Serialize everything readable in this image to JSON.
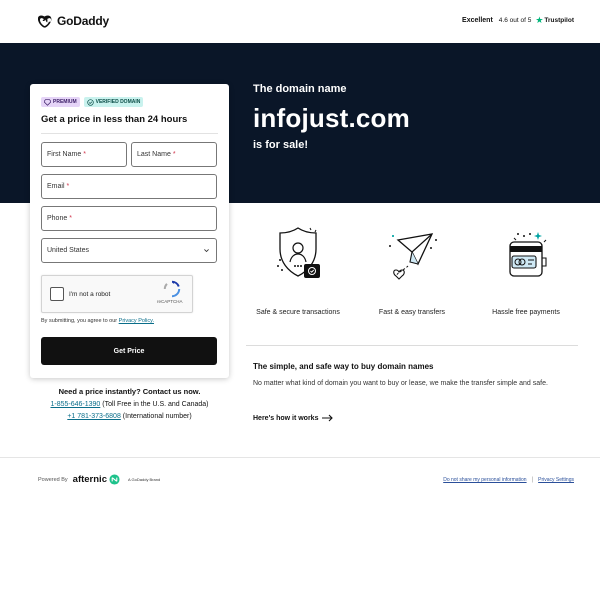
{
  "header": {
    "logo_text": "GoDaddy",
    "rating_label": "Excellent",
    "rating_score": "4.6 out of 5",
    "trustpilot": "Trustpilot"
  },
  "hero": {
    "small_title": "The domain name",
    "domain": "infojust.com",
    "sale_text": "is for sale!"
  },
  "form": {
    "badge_premium": "PREMIUM",
    "badge_verified": "VERIFIED DOMAIN",
    "title": "Get a price in less than 24 hours",
    "first_name": "First Name",
    "last_name": "Last Name",
    "email": "Email",
    "phone": "Phone",
    "required_marker": "*",
    "country": "United States",
    "captcha_label": "I'm not a robot",
    "captcha_brand": "reCAPTCHA",
    "consent_prefix": "By submitting, you agree to our",
    "privacy_link": "Privacy Policy.",
    "submit": "Get Price"
  },
  "contact": {
    "title": "Need a price instantly? Contact us now.",
    "phone_us": "1-855-646-1390",
    "phone_us_note": "(Toll Free in the U.S. and Canada)",
    "phone_intl": "+1 781-373-6808",
    "phone_intl_note": "(International number)"
  },
  "features": [
    {
      "label": "Safe & secure transactions",
      "icon": "shield-lock-icon"
    },
    {
      "label": "Fast & easy transfers",
      "icon": "paper-plane-icon"
    },
    {
      "label": "Hassle free payments",
      "icon": "wallet-card-icon"
    }
  ],
  "info": {
    "title": "The simple, and safe way to buy domain names",
    "description": "No matter what kind of domain you want to buy or lease, we make the transfer simple and safe.",
    "link": "Here's how it works"
  },
  "footer": {
    "powered_by": "Powered By",
    "afternic": "afternic",
    "brand_note": "A GoDaddy Brand",
    "link_privacy": "Do not share my personal information",
    "link_settings": "Privacy Settings"
  },
  "colors": {
    "hero_bg": "#0a1628",
    "trustpilot_green": "#00b67a",
    "link": "#0a6e8a",
    "button": "#111111"
  }
}
